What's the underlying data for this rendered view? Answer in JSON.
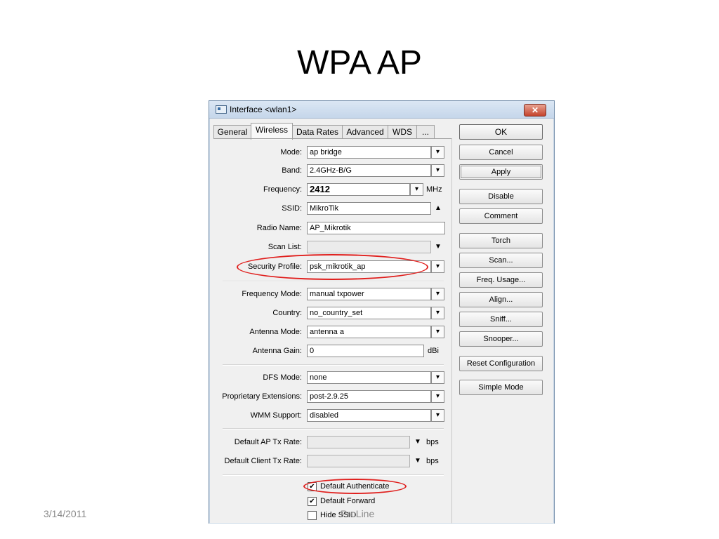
{
  "slide": {
    "title": "WPA AP",
    "date": "3/14/2011",
    "footer": "ProLine"
  },
  "window": {
    "title": "Interface <wlan1>",
    "close_glyph": "✕"
  },
  "tabs": [
    {
      "label": "General"
    },
    {
      "label": "Wireless",
      "active": true
    },
    {
      "label": "Data Rates"
    },
    {
      "label": "Advanced"
    },
    {
      "label": "WDS"
    },
    {
      "label": "..."
    }
  ],
  "form": {
    "mode": {
      "label": "Mode:",
      "value": "ap bridge"
    },
    "band": {
      "label": "Band:",
      "value": "2.4GHz-B/G"
    },
    "frequency": {
      "label": "Frequency:",
      "value": "2412",
      "unit": "MHz"
    },
    "ssid": {
      "label": "SSID:",
      "value": "MikroTik"
    },
    "radio_name": {
      "label": "Radio Name:",
      "value": "AP_Mikrotik"
    },
    "scan_list": {
      "label": "Scan List:",
      "value": ""
    },
    "security_profile": {
      "label": "Security Profile:",
      "value": "psk_mikrotik_ap"
    },
    "frequency_mode": {
      "label": "Frequency Mode:",
      "value": "manual txpower"
    },
    "country": {
      "label": "Country:",
      "value": "no_country_set"
    },
    "antenna_mode": {
      "label": "Antenna Mode:",
      "value": "antenna a"
    },
    "antenna_gain": {
      "label": "Antenna Gain:",
      "value": "0",
      "unit": "dBi"
    },
    "dfs_mode": {
      "label": "DFS Mode:",
      "value": "none"
    },
    "proprietary_extensions": {
      "label": "Proprietary Extensions:",
      "value": "post-2.9.25"
    },
    "wmm_support": {
      "label": "WMM Support:",
      "value": "disabled"
    },
    "default_ap_tx_rate": {
      "label": "Default AP Tx Rate:",
      "value": "",
      "unit": "bps"
    },
    "default_client_tx_rate": {
      "label": "Default Client Tx Rate:",
      "value": "",
      "unit": "bps"
    },
    "default_authenticate": {
      "label": "Default Authenticate",
      "checked": true
    },
    "default_forward": {
      "label": "Default Forward",
      "checked": true
    },
    "hide_ssid": {
      "label": "Hide SSID",
      "checked": false
    }
  },
  "buttons": {
    "ok": "OK",
    "cancel": "Cancel",
    "apply": "Apply",
    "disable": "Disable",
    "comment": "Comment",
    "torch": "Torch",
    "scan": "Scan...",
    "freq_usage": "Freq. Usage...",
    "align": "Align...",
    "sniff": "Sniff...",
    "snooper": "Snooper...",
    "reset_configuration": "Reset Configuration",
    "simple_mode": "Simple Mode"
  },
  "glyphs": {
    "dropdown": "▾",
    "dropdown_filled": "▼",
    "collapse": "▲",
    "check": "✔"
  },
  "annotations": {
    "highlight_color": "#e0201e"
  }
}
